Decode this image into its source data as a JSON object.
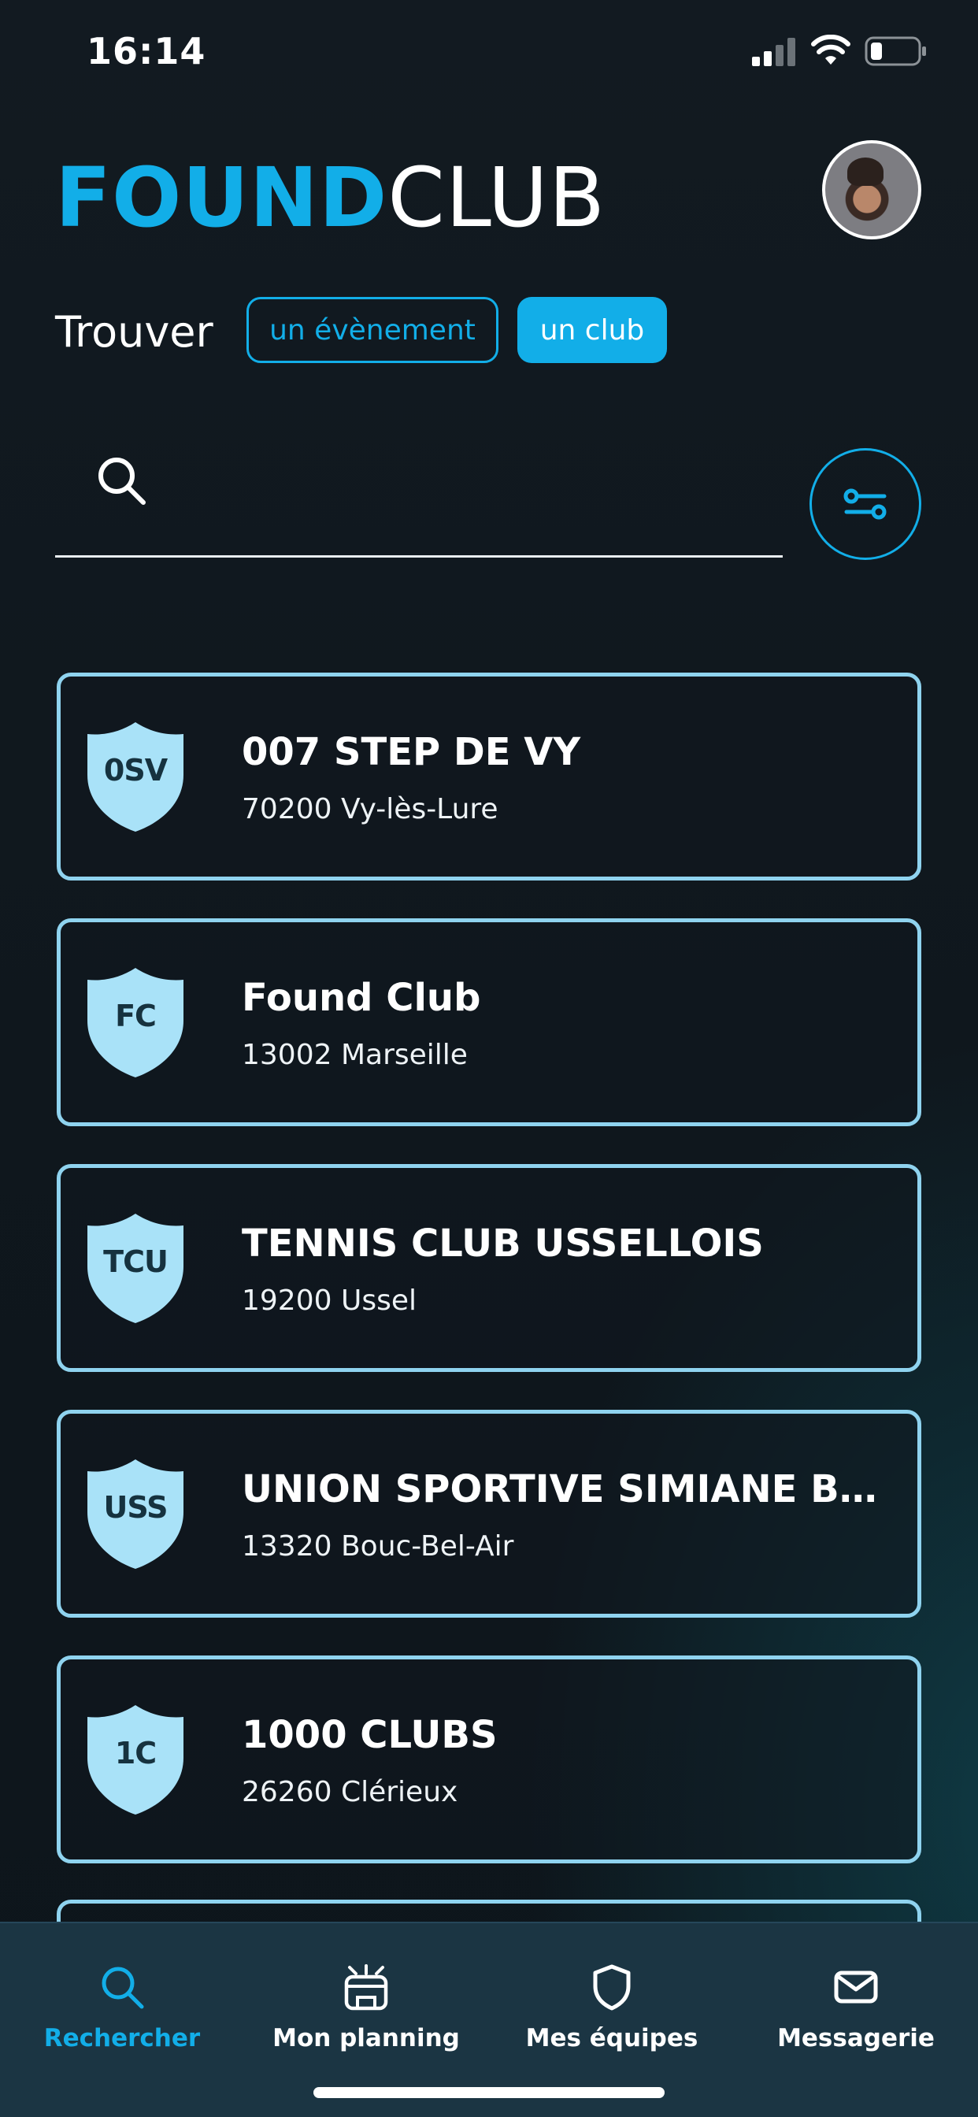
{
  "status_bar": {
    "time": "16:14"
  },
  "header": {
    "logo_part1": "FOUND",
    "logo_part2": "CLUB"
  },
  "filter": {
    "label": "Trouver",
    "option_event": "un évènement",
    "option_club": "un club",
    "selected": "un club"
  },
  "search": {
    "value": "",
    "placeholder": ""
  },
  "clubs": [
    {
      "initials": "0SV",
      "name": "007 STEP DE VY",
      "location": "70200 Vy-lès-Lure"
    },
    {
      "initials": "FC",
      "name": "Found Club",
      "location": "13002 Marseille"
    },
    {
      "initials": "TCU",
      "name": "TENNIS CLUB USSELLOIS",
      "location": "19200 Ussel"
    },
    {
      "initials": "USS",
      "name": "UNION SPORTIVE SIMIANE BO...",
      "location": "13320 Bouc-Bel-Air"
    },
    {
      "initials": "1C",
      "name": "1000 CLUBS",
      "location": "26260 Clérieux"
    }
  ],
  "tab_bar": {
    "tabs": [
      {
        "label": "Rechercher",
        "icon": "search-icon",
        "active": true
      },
      {
        "label": "Mon planning",
        "icon": "calendar-icon",
        "active": false
      },
      {
        "label": "Mes équipes",
        "icon": "shield-icon",
        "active": false
      },
      {
        "label": "Messagerie",
        "icon": "mail-icon",
        "active": false
      }
    ]
  },
  "colors": {
    "accent": "#12aee8",
    "card_border": "#8fd3ef",
    "crest": "#a9e2f8",
    "tab_bar": "#1b3543"
  }
}
